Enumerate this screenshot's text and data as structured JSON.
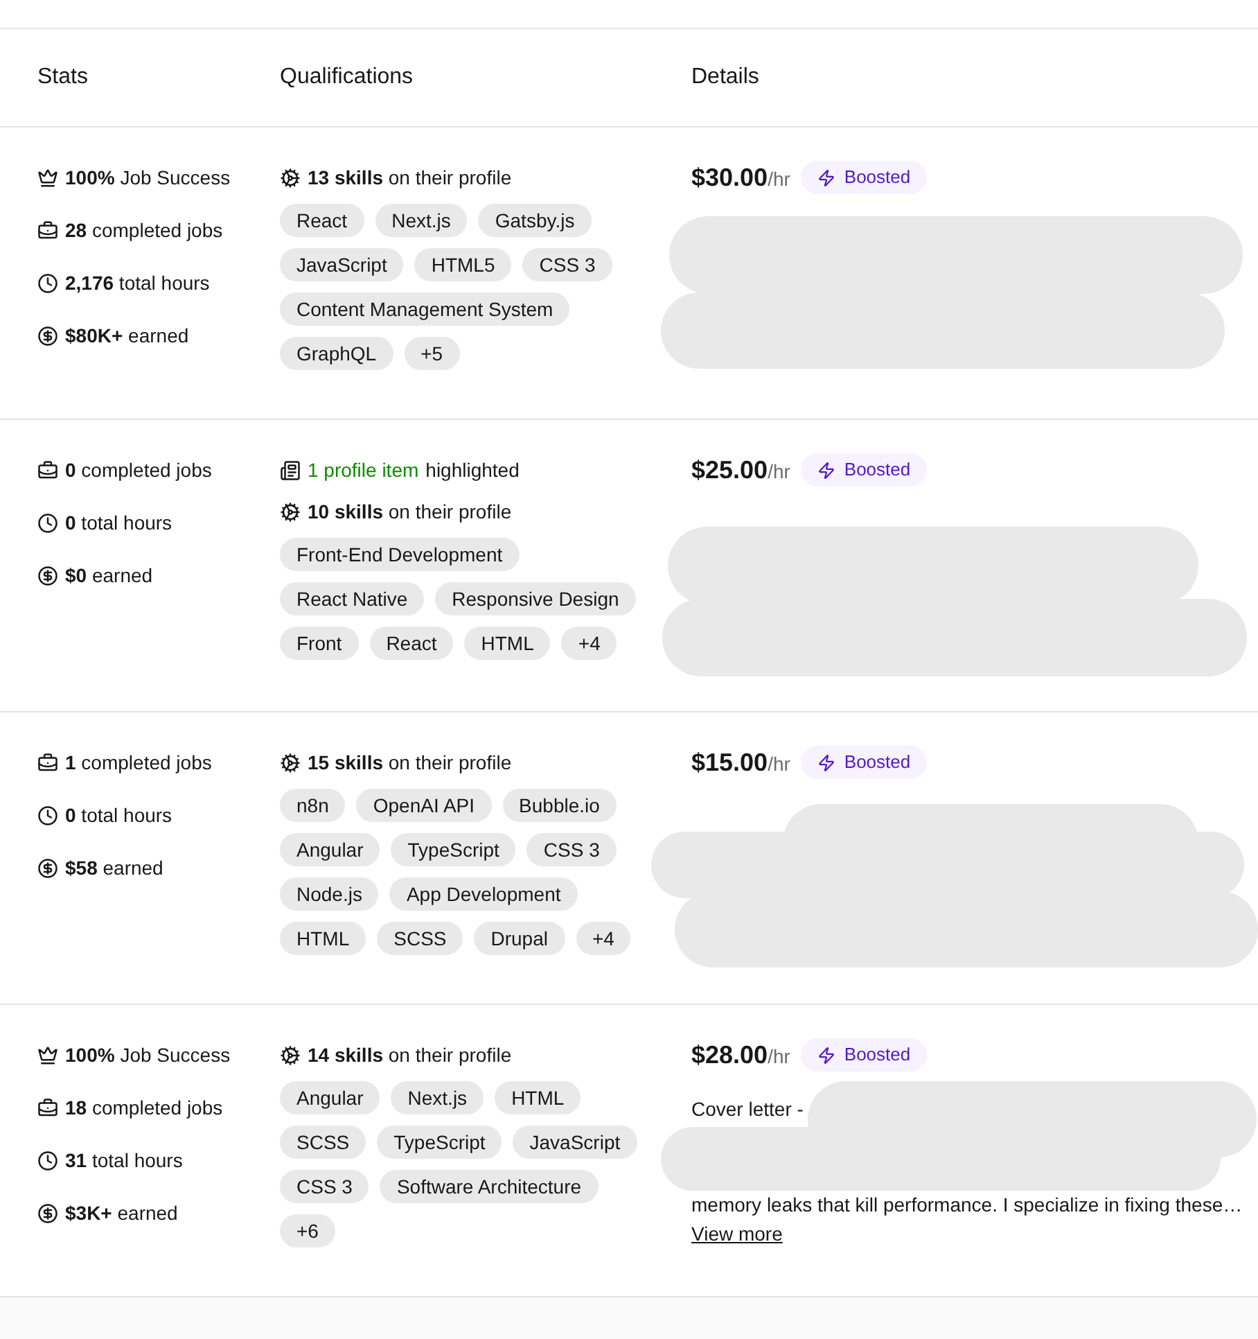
{
  "columns": [
    "Stats",
    "Qualifications",
    "Details"
  ],
  "rows": [
    {
      "stats": [
        {
          "kind": "success",
          "text": "**100%** Job Success"
        },
        {
          "kind": "jobs",
          "text": "**28** completed jobs"
        },
        {
          "kind": "hours",
          "text": "**2,176** total hours"
        },
        {
          "kind": "earned",
          "text": "**$80K+** earned"
        }
      ],
      "skills_line": "**13 skills** on their profile",
      "tags": [
        "React",
        "Next.js",
        "Gatsby.js",
        "JavaScript",
        "HTML5",
        "CSS 3",
        "Content Management System",
        "GraphQL",
        "+5"
      ],
      "rate": "$30.00",
      "rate_unit": "/hr",
      "badge": "Boosted"
    },
    {
      "stats": [
        {
          "kind": "jobs",
          "text": "**0** completed jobs"
        },
        {
          "kind": "hours",
          "text": "**0** total hours"
        },
        {
          "kind": "earned",
          "text": "**$0** earned"
        }
      ],
      "highlight": {
        "link": "1 profile item",
        "text": "highlighted"
      },
      "skills_line": "**10 skills** on their profile",
      "tags": [
        "Front-End Development",
        "React Native",
        "Responsive Design",
        "Front",
        "React",
        "HTML",
        "+4"
      ],
      "rate": "$25.00",
      "rate_unit": "/hr",
      "badge": "Boosted"
    },
    {
      "stats": [
        {
          "kind": "jobs",
          "text": "**1** completed jobs"
        },
        {
          "kind": "hours",
          "text": "**0** total hours"
        },
        {
          "kind": "earned",
          "text": "**$58** earned"
        }
      ],
      "skills_line": "**15 skills** on their profile",
      "tags": [
        "n8n",
        "OpenAI API",
        "Bubble.io",
        "Angular",
        "TypeScript",
        "CSS 3",
        "Node.js",
        "App Development",
        "HTML",
        "SCSS",
        "Drupal",
        "+4"
      ],
      "rate": "$15.00",
      "rate_unit": "/hr",
      "badge": "Boosted"
    },
    {
      "stats": [
        {
          "kind": "success",
          "text": "**100%** Job Success"
        },
        {
          "kind": "jobs",
          "text": "**18** completed jobs"
        },
        {
          "kind": "hours",
          "text": "**31** total hours"
        },
        {
          "kind": "earned",
          "text": "**$3K+** earned"
        }
      ],
      "skills_line": "**14 skills** on their profile",
      "tags": [
        "Angular",
        "Next.js",
        "HTML",
        "SCSS",
        "TypeScript",
        "JavaScript",
        "CSS 3",
        "Software Architecture",
        "+6"
      ],
      "rate": "$28.00",
      "rate_unit": "/hr",
      "badge": "Boosted",
      "cover_letter": {
        "lead": "Cover letter -",
        "tail": "memory leaks that kill performance. I specialize in fixing these…",
        "link": "View more"
      }
    }
  ]
}
